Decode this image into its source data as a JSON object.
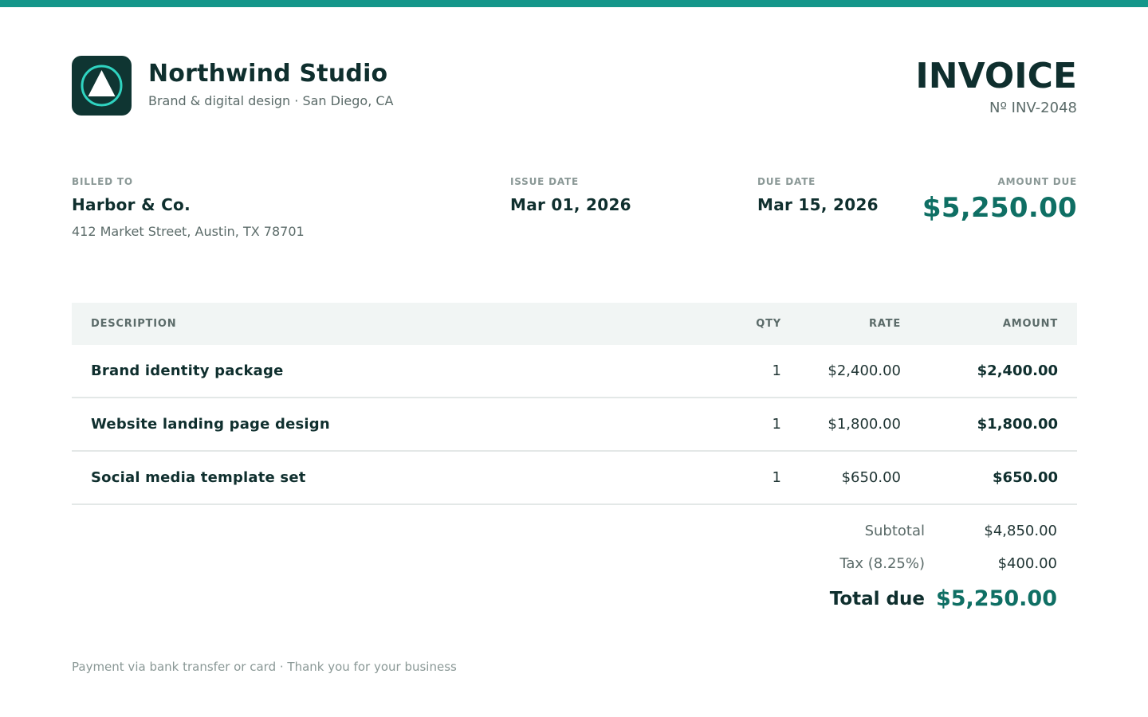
{
  "theme": {
    "accent": "#14968a",
    "accent_dark": "#0f6f64",
    "logo_bg": "#0f3532",
    "logo_ring": "#2fd3c0",
    "text_dark": "#0f2f2e",
    "text_muted": "#5b6b69"
  },
  "brand": {
    "logo_icon": "triangle-ring-logo-icon",
    "name": "Northwind Studio",
    "tagline": "Brand & digital design · San Diego, CA"
  },
  "invoice": {
    "title": "INVOICE",
    "number": "Nº INV-2048"
  },
  "meta": {
    "billed_to": {
      "label": "BILLED TO",
      "name": "Harbor & Co.",
      "address": "412 Market Street, Austin, TX 78701"
    },
    "issue_date": {
      "label": "ISSUE DATE",
      "value": "Mar 01, 2026"
    },
    "due_date": {
      "label": "DUE DATE",
      "value": "Mar 15, 2026"
    },
    "amount_due": {
      "label": "AMOUNT DUE",
      "value": "$5,250.00"
    }
  },
  "table": {
    "headers": {
      "description": "DESCRIPTION",
      "qty": "QTY",
      "rate": "RATE",
      "amount": "AMOUNT"
    },
    "rows": [
      {
        "description": "Brand identity package",
        "qty": "1",
        "rate": "$2,400.00",
        "amount": "$2,400.00"
      },
      {
        "description": "Website landing page design",
        "qty": "1",
        "rate": "$1,800.00",
        "amount": "$1,800.00"
      },
      {
        "description": "Social media template set",
        "qty": "1",
        "rate": "$650.00",
        "amount": "$650.00"
      }
    ]
  },
  "totals": {
    "subtotal_label": "Subtotal",
    "subtotal_value": "$4,850.00",
    "tax_label": "Tax (8.25%)",
    "tax_value": "$400.00",
    "total_label": "Total due",
    "total_value": "$5,250.00"
  },
  "footer": {
    "note": "Payment via bank transfer or card · Thank you for your business"
  }
}
